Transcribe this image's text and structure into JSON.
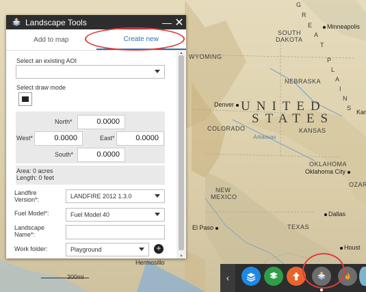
{
  "map": {
    "country_label": "UNITED STATES",
    "country_line1": "UNITED",
    "country_line2": "STATES",
    "great_plains": [
      "G",
      "R",
      "E",
      "A",
      "T",
      "P",
      "L",
      "A",
      "I",
      "N",
      "S"
    ],
    "states": [
      "SOUTH",
      "DAKOTA",
      "WYOMING",
      "NEBRASKA",
      "COLORADO",
      "KANSAS",
      "OKLAHOMA",
      "NEW",
      "MEXICO",
      "TEXAS",
      "OZARK"
    ],
    "cities": [
      "Minneapolis",
      "Denver",
      "Oklahoma City",
      "Dallas",
      "El Paso",
      "Houston",
      "Hermosillo"
    ],
    "rivers": [
      "Arkansas"
    ],
    "scale": "300mi",
    "edge_labels": [
      "Kan",
      "Houst"
    ]
  },
  "panel": {
    "title": "Landscape Tools",
    "tabs": [
      {
        "label": "Add to map"
      },
      {
        "label": "Create new"
      }
    ],
    "aoi_label": "Select an existing AOI",
    "aoi_value": "",
    "draw_mode_label": "Select draw mode",
    "coords": {
      "north_label": "North*",
      "north_value": "0.0000",
      "west_label": "West*",
      "west_value": "0.0000",
      "east_label": "East*",
      "east_value": "0.0000",
      "south_label": "South*",
      "south_value": "0.0000"
    },
    "area_text": "Area: 0 acres",
    "length_text": "Length: 0 feet",
    "landfire_label_1": "Landfire",
    "landfire_label_2": "Version*:",
    "landfire_value": "LANDFIRE 2012 1.3.0",
    "fuel_label": "Fuel Model*:",
    "fuel_value": "Fuel Model 40",
    "landscape_label_1": "Landscape",
    "landscape_label_2": "Name*:",
    "landscape_value": "",
    "workfolder_label": "Work folder:",
    "workfolder_value": "Playground"
  },
  "dock": {
    "buttons": [
      {
        "name": "layers-icon",
        "color": "#1e88e5"
      },
      {
        "name": "basemap-icon",
        "color": "#2e9e48"
      },
      {
        "name": "upload-icon",
        "color": "#e8642c"
      },
      {
        "name": "landscape-tools-icon",
        "color": "#6d6d6d"
      },
      {
        "name": "fire-icon",
        "color": "#6d6d6d"
      }
    ]
  },
  "accent_color": "#2d6db3",
  "highlight_color": "#e23c3c"
}
